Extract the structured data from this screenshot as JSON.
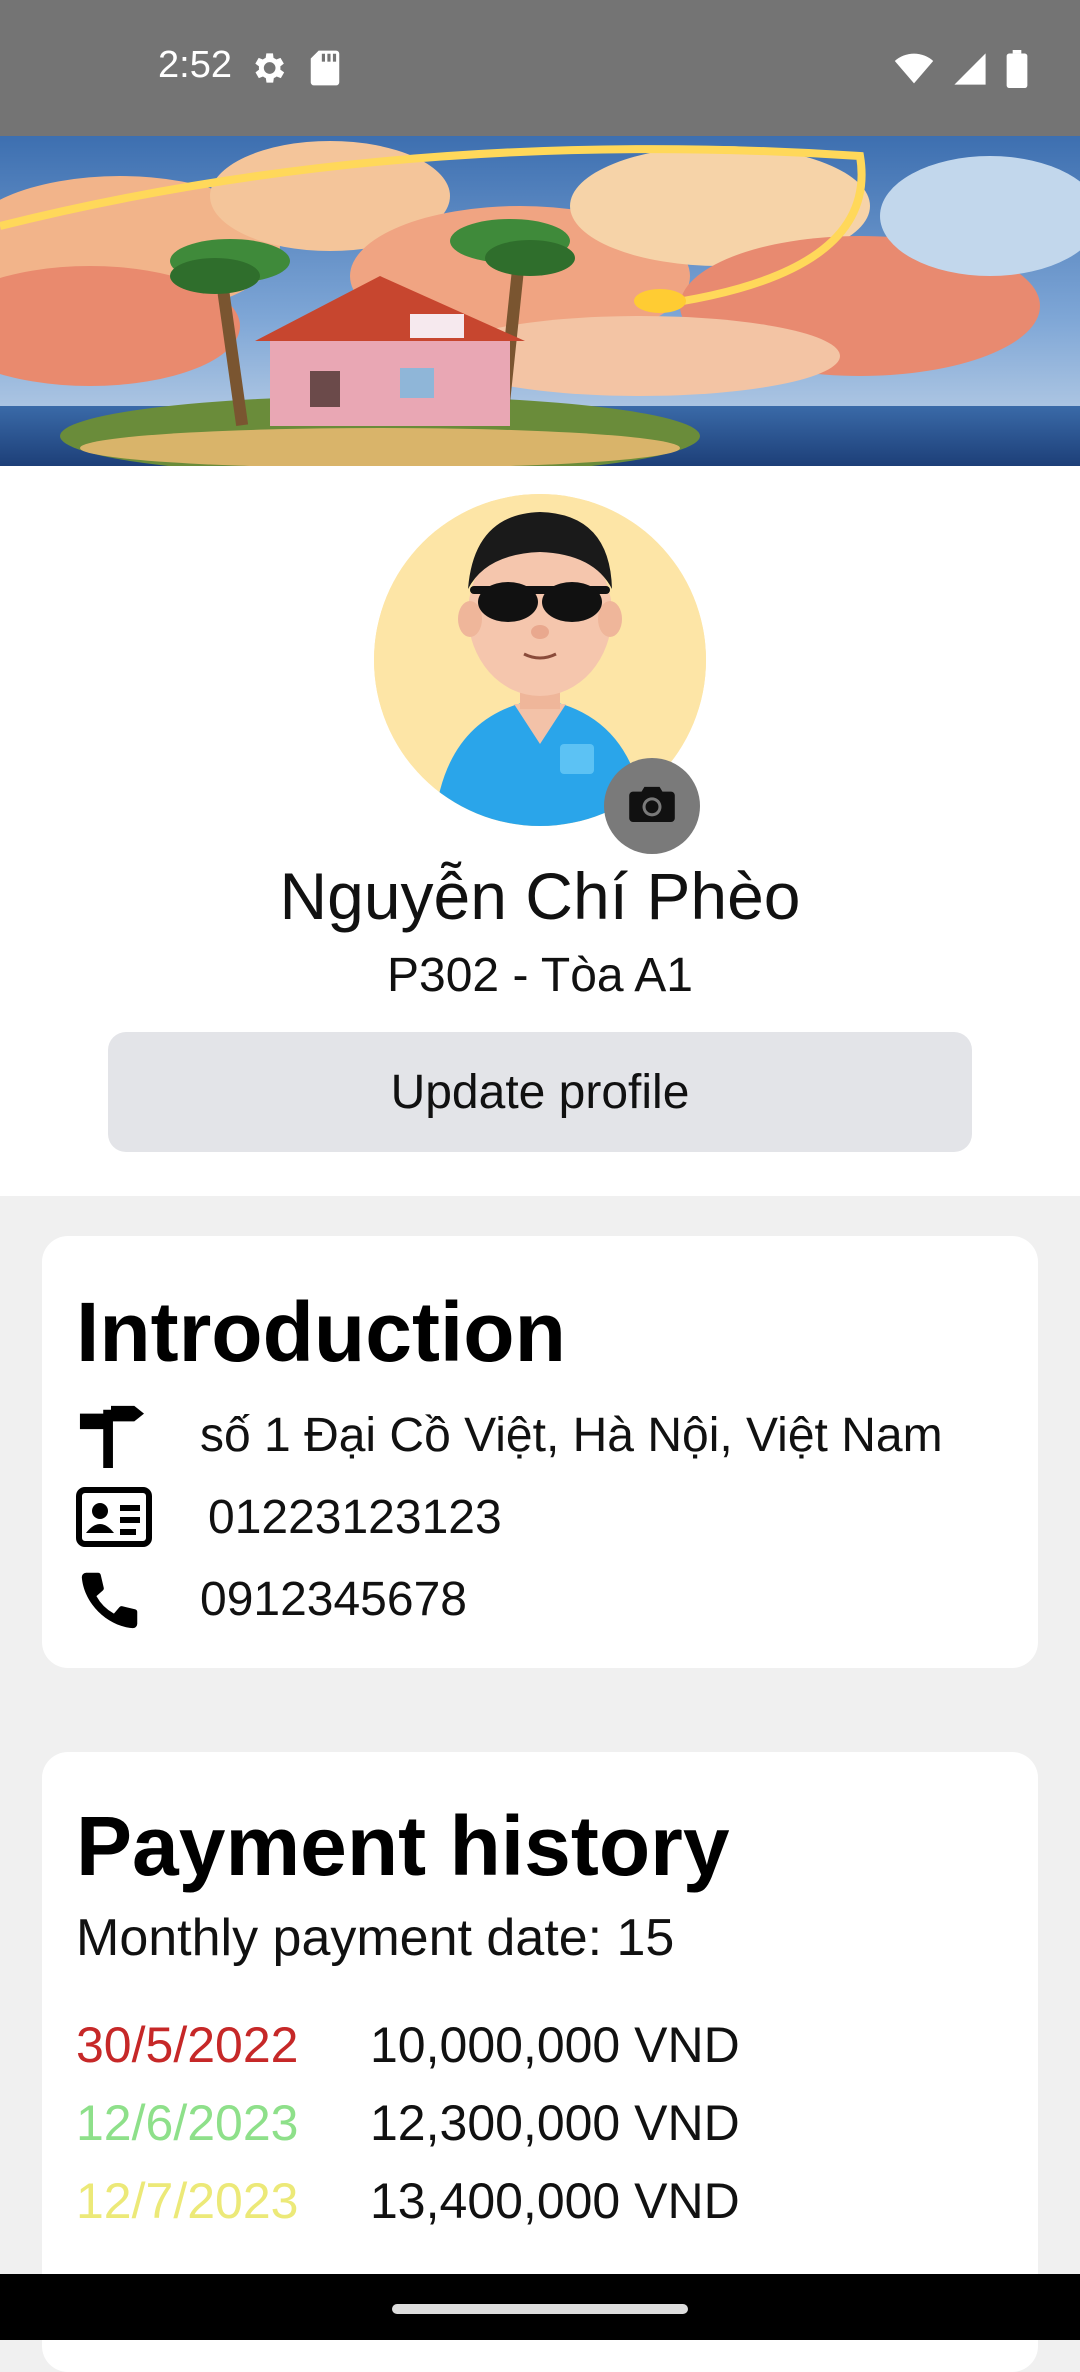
{
  "status_bar": {
    "time": "2:52",
    "left_icons": [
      "settings-gear-icon",
      "sd-card-icon"
    ],
    "right_icons": [
      "wifi-icon",
      "signal-icon",
      "battery-icon"
    ]
  },
  "banner": {
    "image": "tropical island house with palm trees and sunset sky"
  },
  "profile": {
    "name": "Nguyễn Chí Phèo",
    "room": "P302 - Tòa A1",
    "update_button": "Update profile",
    "avatar": "3D cartoon man with sunglasses and blue shirt",
    "camera_icon": "camera-icon"
  },
  "introduction": {
    "title": "Introduction",
    "address": "số 1 Đại Cồ Việt, Hà Nội, Việt Nam",
    "id_number": "01223123123",
    "phone": "0912345678",
    "icons": [
      "signpost-icon",
      "id-card-icon",
      "phone-icon"
    ]
  },
  "payment": {
    "title": "Payment history",
    "monthly_date": "Monthly payment date: 15",
    "rows": [
      {
        "date": "30/5/2022",
        "amount": "10,000,000 VND",
        "color": "#c62828"
      },
      {
        "date": "12/6/2023",
        "amount": "12,300,000 VND",
        "color": "#8ee08a"
      },
      {
        "date": "12/7/2023",
        "amount": "13,400,000 VND",
        "color": "#ece978"
      }
    ]
  },
  "colors": {
    "status_bar": "#747474",
    "background": "#f0f0f0",
    "button_bg": "#e3e4e8",
    "camera_bg": "#7a7a7a",
    "avatar_bg": "#fde5a6"
  }
}
